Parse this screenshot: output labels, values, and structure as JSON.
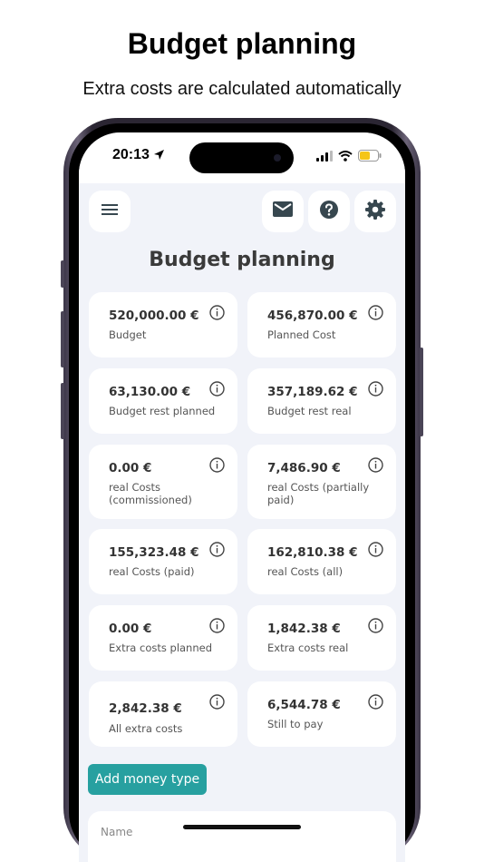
{
  "promo": {
    "title": "Budget planning",
    "subtitle": "Extra costs are calculated automatically"
  },
  "status_bar": {
    "time": "20:13",
    "icons": [
      "location-arrow-icon",
      "signal-bars-icon",
      "wifi-icon",
      "battery-icon"
    ],
    "battery_color": "#f5c518"
  },
  "toolbar": {
    "menu_icon": "hamburger-menu-icon",
    "mail_icon": "mail-icon",
    "help_icon": "help-icon",
    "settings_icon": "gear-icon"
  },
  "page": {
    "title": "Budget planning"
  },
  "cards": [
    {
      "value": "520,000.00 €",
      "label": "Budget"
    },
    {
      "value": "456,870.00 €",
      "label": "Planned Cost"
    },
    {
      "value": "63,130.00 €",
      "label": "Budget rest planned"
    },
    {
      "value": "357,189.62 €",
      "label": "Budget rest real"
    },
    {
      "value": "0.00 €",
      "label": "real Costs (commissioned)"
    },
    {
      "value": "7,486.90 €",
      "label": "real Costs (partially paid)"
    },
    {
      "value": "155,323.48 €",
      "label": "real Costs (paid)"
    },
    {
      "value": "162,810.38 €",
      "label": "real Costs (all)"
    },
    {
      "value": "0.00 €",
      "label": "Extra costs planned"
    },
    {
      "value": "1,842.38 €",
      "label": "Extra costs real"
    },
    {
      "value": "2,842.38 €",
      "label": "All extra costs"
    },
    {
      "value": "6,544.78 €",
      "label": "Still to pay"
    }
  ],
  "actions": {
    "add_money_type": "Add money type"
  },
  "list": {
    "name_header": "Name"
  },
  "colors": {
    "accent": "#27a0a0",
    "screen_bg": "#f1f3f9",
    "card_bg": "#ffffff",
    "icon": "#37474f"
  }
}
